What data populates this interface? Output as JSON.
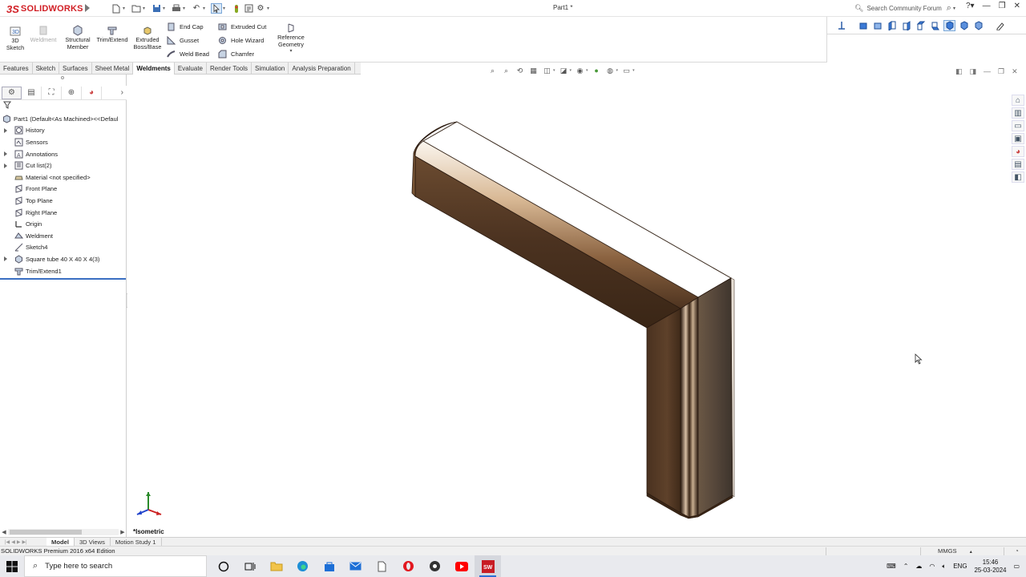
{
  "app": {
    "brand": "SOLIDWORKS",
    "brand_prefix": "3S",
    "document_title": "Part1 *",
    "search_placeholder": "Search Community Forum"
  },
  "commands": {
    "sketch3d": "3D Sketch",
    "weldment": "Weldment",
    "structural_member": "Structural Member",
    "trim_extend": "Trim/Extend",
    "extruded_boss": "Extruded Boss/Base",
    "end_cap": "End Cap",
    "gusset": "Gusset",
    "weld_bead": "Weld Bead",
    "extruded_cut": "Extruded Cut",
    "hole_wizard": "Hole Wizard",
    "chamfer": "Chamfer",
    "reference_geometry": "Reference Geometry"
  },
  "tabs": [
    "Features",
    "Sketch",
    "Surfaces",
    "Sheet Metal",
    "Weldments",
    "Evaluate",
    "Render Tools",
    "Simulation",
    "Analysis Preparation"
  ],
  "active_tab": "Weldments",
  "tree": {
    "root": "Part1  (Default<As Machined><<Defaul",
    "items": [
      {
        "label": "History",
        "expandable": true,
        "icon": "history-icon"
      },
      {
        "label": "Sensors",
        "expandable": false,
        "icon": "sensor-icon"
      },
      {
        "label": "Annotations",
        "expandable": true,
        "icon": "annotation-icon"
      },
      {
        "label": "Cut list(2)",
        "expandable": true,
        "icon": "cut-list-icon"
      },
      {
        "label": "Material <not specified>",
        "expandable": false,
        "icon": "material-icon"
      },
      {
        "label": "Front Plane",
        "expandable": false,
        "icon": "plane-icon"
      },
      {
        "label": "Top Plane",
        "expandable": false,
        "icon": "plane-icon"
      },
      {
        "label": "Right Plane",
        "expandable": false,
        "icon": "plane-icon"
      },
      {
        "label": "Origin",
        "expandable": false,
        "icon": "origin-icon"
      },
      {
        "label": "Weldment",
        "expandable": false,
        "icon": "weldment-icon"
      },
      {
        "label": "Sketch4",
        "expandable": false,
        "icon": "sketch-icon"
      },
      {
        "label": "Square tube 40 X 40 X 4(3)",
        "expandable": true,
        "icon": "structural-member-icon"
      },
      {
        "label": "Trim/Extend1",
        "expandable": false,
        "icon": "trim-extend-icon"
      }
    ]
  },
  "viewport": {
    "view_name": "*Isometric"
  },
  "bottom_tabs": [
    "Model",
    "3D Views",
    "Motion Study 1"
  ],
  "active_bottom_tab": "Model",
  "status": {
    "edition": "SOLIDWORKS Premium 2016 x64 Edition",
    "units": "MMGS"
  },
  "taskbar": {
    "search_placeholder": "Type here to search",
    "language": "ENG",
    "time": "15:46",
    "date": "25-03-2024"
  },
  "colors": {
    "brand": "#d11f25",
    "active_blue": "#3a6fc2",
    "model_brown": "#5a3b22"
  }
}
